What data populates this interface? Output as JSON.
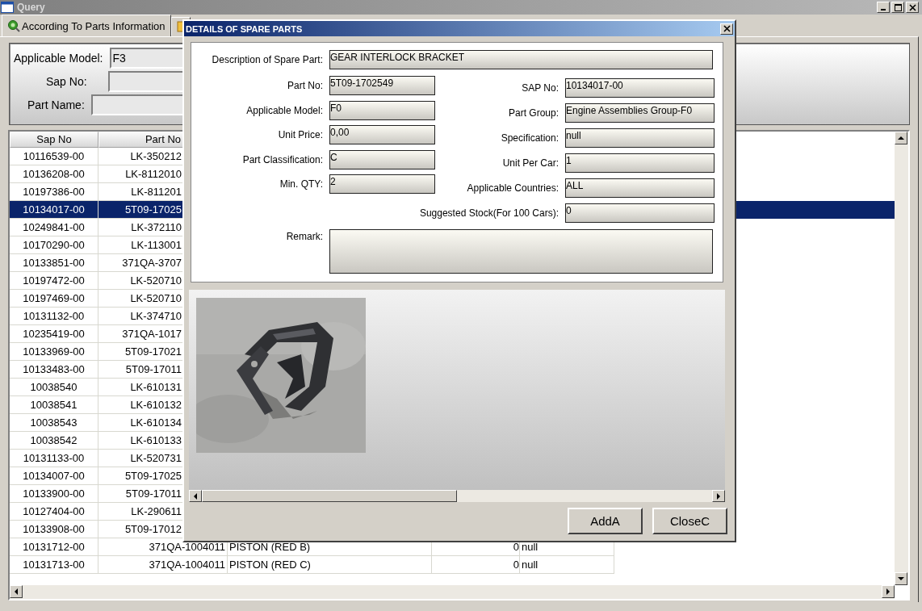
{
  "window": {
    "title": "Query"
  },
  "tabs": [
    {
      "label": "According To Parts Information",
      "selected": true
    },
    {
      "selected": false
    }
  ],
  "filters": [
    {
      "label": "Applicable Model:",
      "value": "F3",
      "kind": "select"
    },
    {
      "label": "Sap No:",
      "kind": "text"
    },
    {
      "label": "Part Name:",
      "kind": "text"
    }
  ],
  "table": {
    "columns": [
      "Sap No",
      "Part No"
    ],
    "rows": [
      {
        "sap_no": "10116539-00",
        "part_no": "LK-350212",
        "selected": false
      },
      {
        "sap_no": "10136208-00",
        "part_no": "LK-8112010",
        "selected": false
      },
      {
        "sap_no": "10197386-00",
        "part_no": "LK-811201",
        "selected": false
      },
      {
        "sap_no": "10134017-00",
        "part_no": "5T09-17025",
        "selected": true
      },
      {
        "sap_no": "10249841-00",
        "part_no": "LK-372110",
        "selected": false
      },
      {
        "sap_no": "10170290-00",
        "part_no": "LK-113001",
        "selected": false
      },
      {
        "sap_no": "10133851-00",
        "part_no": "371QA-3707",
        "selected": false
      },
      {
        "sap_no": "10197472-00",
        "part_no": "LK-520710",
        "selected": false
      },
      {
        "sap_no": "10197469-00",
        "part_no": "LK-520710",
        "selected": false
      },
      {
        "sap_no": "10131132-00",
        "part_no": "LK-374710",
        "selected": false
      },
      {
        "sap_no": "10235419-00",
        "part_no": "371QA-1017",
        "selected": false
      },
      {
        "sap_no": "10133969-00",
        "part_no": "5T09-17021",
        "selected": false
      },
      {
        "sap_no": "10133483-00",
        "part_no": "5T09-17011",
        "selected": false
      },
      {
        "sap_no": "10038540",
        "part_no": "LK-610131",
        "selected": false
      },
      {
        "sap_no": "10038541",
        "part_no": "LK-610132",
        "selected": false
      },
      {
        "sap_no": "10038543",
        "part_no": "LK-610134",
        "selected": false
      },
      {
        "sap_no": "10038542",
        "part_no": "LK-610133",
        "selected": false
      },
      {
        "sap_no": "10131133-00",
        "part_no": "LK-520731",
        "selected": false
      },
      {
        "sap_no": "10134007-00",
        "part_no": "5T09-17025",
        "selected": false
      },
      {
        "sap_no": "10133900-00",
        "part_no": "5T09-17011",
        "selected": false
      },
      {
        "sap_no": "10127404-00",
        "part_no": "LK-290611",
        "selected": false
      },
      {
        "sap_no": "10133908-00",
        "part_no": "5T09-17012",
        "selected": false
      },
      {
        "sap_no": "10131712-00",
        "part_no": "371QA-1004011",
        "part_name": "PISTON (RED B)",
        "column_4": "0",
        "column_5": "null",
        "selected": false
      },
      {
        "sap_no": "10131713-00",
        "part_no": "371QA-1004011",
        "part_name": "PISTON (RED C)",
        "column_4": "0",
        "column_5": "null",
        "selected": false
      }
    ]
  },
  "dialog": {
    "title": "DETAILS OF SPARE PARTS",
    "description": {
      "label": "Description of Spare Part:",
      "value": "GEAR INTERLOCK BRACKET"
    },
    "left_fields": [
      {
        "label": "Part No:",
        "value": "5T09-1702549"
      },
      {
        "label": "Applicable Model:",
        "value": "F0"
      },
      {
        "label": "Unit Price:",
        "value": "0,00"
      },
      {
        "label": "Part Classification:",
        "value": "C"
      },
      {
        "label": "Min. QTY:",
        "value": "2"
      }
    ],
    "right_fields": [
      {
        "label": "SAP No:",
        "value": "10134017-00"
      },
      {
        "label": "Part Group:",
        "value": "Engine Assemblies Group-F0"
      },
      {
        "label": "Specification:",
        "value": "null"
      },
      {
        "label": "Unit Per Car:",
        "value": "1"
      },
      {
        "label": "Applicable Countries:",
        "value": "ALL"
      }
    ],
    "suggested_stock": {
      "label": "Suggested Stock(For 100 Cars):",
      "value": "0"
    },
    "remark": {
      "label": "Remark:"
    },
    "image": {
      "kind": "picture"
    },
    "buttons": [
      "AddA",
      "CloseC"
    ]
  }
}
